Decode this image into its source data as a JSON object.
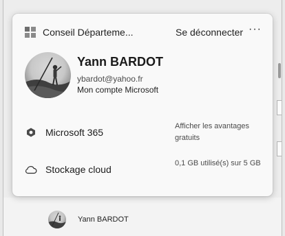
{
  "account_menu": {
    "org_name": "Conseil Départeme...",
    "signout_label": "Se déconnecter",
    "more_label": "···",
    "user": {
      "name": "Yann BARDOT",
      "email": "ybardot@yahoo.fr",
      "account_link": "Mon compte Microsoft"
    },
    "microsoft365": {
      "label": "Microsoft 365",
      "side_text": "Afficher les avantages gratuits"
    },
    "cloud_storage": {
      "label": "Stockage cloud",
      "side_text": "0,1 GB utilisé(s) sur 5 GB"
    }
  },
  "taskbar_user": {
    "name": "Yann BARDOT"
  }
}
